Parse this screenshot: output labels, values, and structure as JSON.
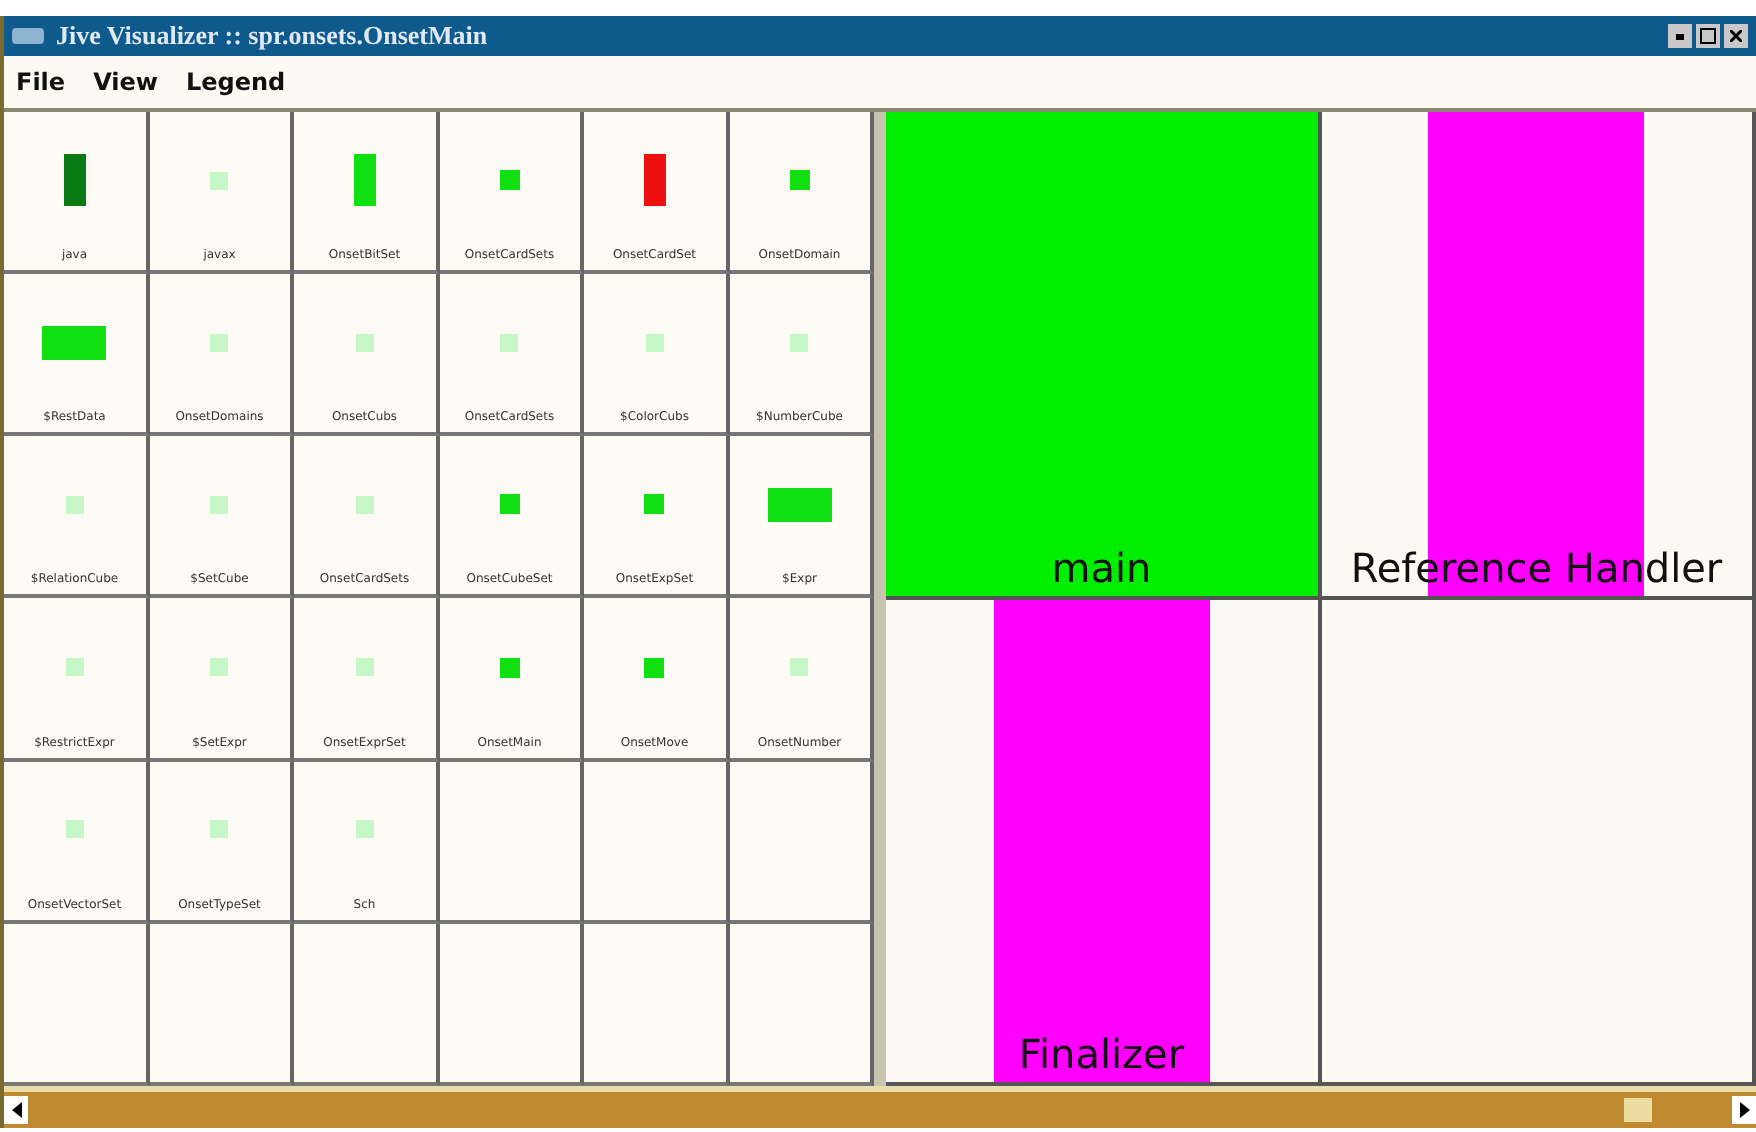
{
  "window": {
    "title": "Jive Visualizer :: spr.onsets.OnsetMain"
  },
  "menu": [
    {
      "label": "File"
    },
    {
      "label": "View"
    },
    {
      "label": "Legend"
    }
  ],
  "classes": [
    {
      "label": "java",
      "color": "#0a7a12",
      "kind": "tall"
    },
    {
      "label": "javax",
      "color": "#c6f7c6",
      "kind": "dot"
    },
    {
      "label": "OnsetBitSet",
      "color": "#10e010",
      "kind": "tall"
    },
    {
      "label": "OnsetCardSets",
      "color": "#10e010",
      "kind": "square"
    },
    {
      "label": "OnsetCardSet",
      "color": "#ee1010",
      "kind": "tall"
    },
    {
      "label": "OnsetDomain",
      "color": "#10e010",
      "kind": "square"
    },
    {
      "label": "$RestData",
      "color": "#10e010",
      "kind": "wide"
    },
    {
      "label": "OnsetDomains",
      "color": "#c6f7c6",
      "kind": "dot"
    },
    {
      "label": "OnsetCubs",
      "color": "#c6f7c6",
      "kind": "dot"
    },
    {
      "label": "OnsetCardSets",
      "color": "#c6f7c6",
      "kind": "dot"
    },
    {
      "label": "$ColorCubs",
      "color": "#c6f7c6",
      "kind": "dot"
    },
    {
      "label": "$NumberCube",
      "color": "#c6f7c6",
      "kind": "dot"
    },
    {
      "label": "$RelationCube",
      "color": "#c6f7c6",
      "kind": "dot"
    },
    {
      "label": "$SetCube",
      "color": "#c6f7c6",
      "kind": "dot"
    },
    {
      "label": "OnsetCardSets",
      "color": "#c6f7c6",
      "kind": "dot"
    },
    {
      "label": "OnsetCubeSet",
      "color": "#10e010",
      "kind": "square"
    },
    {
      "label": "OnsetExpSet",
      "color": "#10e010",
      "kind": "square"
    },
    {
      "label": "$Expr",
      "color": "#10e010",
      "kind": "wide"
    },
    {
      "label": "$RestrictExpr",
      "color": "#c6f7c6",
      "kind": "dot"
    },
    {
      "label": "$SetExpr",
      "color": "#c6f7c6",
      "kind": "dot"
    },
    {
      "label": "OnsetExprSet",
      "color": "#c6f7c6",
      "kind": "dot"
    },
    {
      "label": "OnsetMain",
      "color": "#10e010",
      "kind": "square"
    },
    {
      "label": "OnsetMove",
      "color": "#10e010",
      "kind": "square"
    },
    {
      "label": "OnsetNumber",
      "color": "#c6f7c6",
      "kind": "dot"
    },
    {
      "label": "OnsetVectorSet",
      "color": "#c6f7c6",
      "kind": "dot"
    },
    {
      "label": "OnsetTypeSet",
      "color": "#c6f7c6",
      "kind": "dot"
    },
    {
      "label": "Sch",
      "color": "#c6f7c6",
      "kind": "dot"
    }
  ],
  "threads": [
    {
      "label": "main",
      "color": "#00ee00",
      "kind": "full"
    },
    {
      "label": "Reference Handler",
      "color": "#ff00ff",
      "kind": "bar"
    },
    {
      "label": "Finalizer",
      "color": "#ff00ff",
      "kind": "bar"
    }
  ]
}
